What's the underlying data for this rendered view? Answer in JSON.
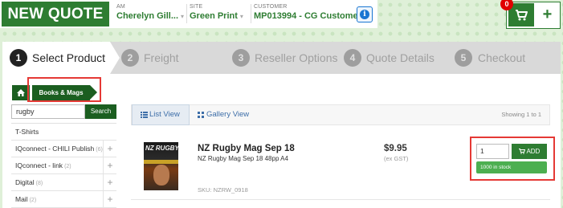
{
  "header": {
    "title": "NEW QUOTE",
    "am_label": "AM",
    "am_value": "Cherelyn Gill...",
    "site_label": "SITE",
    "site_value": "Green Print",
    "customer_label": "CUSTOMER",
    "customer_value": "MP013994 - CG Customer",
    "caret": "▾",
    "info_icon": "i",
    "cart_count": "0",
    "plus_glyph": "+"
  },
  "steps": [
    {
      "num": "1",
      "label": "Select Product"
    },
    {
      "num": "2",
      "label": "Freight"
    },
    {
      "num": "3",
      "label": "Reseller Options"
    },
    {
      "num": "4",
      "label": "Quote Details"
    },
    {
      "num": "5",
      "label": "Checkout"
    }
  ],
  "breadcrumb": {
    "current": "Books & Mags"
  },
  "search": {
    "value": "rugby",
    "button": "Search"
  },
  "categories": [
    {
      "name": "T-Shirts",
      "count": ""
    },
    {
      "name": "IQconnect - CHILI Publish",
      "count": "(6)"
    },
    {
      "name": "IQconnect - link",
      "count": "(2)"
    },
    {
      "name": "Digital",
      "count": "(8)"
    },
    {
      "name": "Mail",
      "count": "(2)"
    }
  ],
  "views": {
    "list": "List View",
    "gallery": "Gallery View",
    "showing": "Showing 1 to 1"
  },
  "product": {
    "thumb_title": "NZ RUGBY",
    "name": "NZ Rugby Mag Sep 18",
    "description": "NZ Rugby Mag Sep 18 48pp A4",
    "sku": "SKU: NZRW_0918",
    "price": "$9.95",
    "price_note": "(ex GST)",
    "qty": "1",
    "add_label": "ADD",
    "stock": "1000 in stock"
  },
  "colors": {
    "brand_green": "#2e7d32",
    "highlight_red": "#e53935",
    "stock_green": "#4caf50"
  },
  "icons": [
    "info-icon",
    "cart-icon",
    "plus-icon",
    "home-icon",
    "list-icon",
    "grid-icon",
    "cart-small-icon"
  ]
}
